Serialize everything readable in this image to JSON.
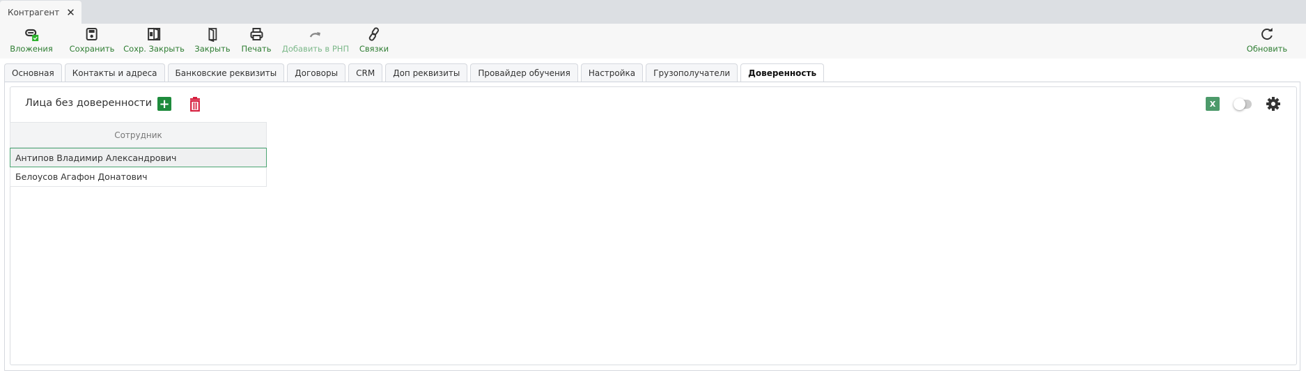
{
  "window_tab": {
    "title": "Контрагент",
    "close_icon": "close-icon"
  },
  "toolbar": {
    "attachments": "Вложения",
    "save": "Сохранить",
    "save_close": "Сохр. Закрыть",
    "close": "Закрыть",
    "print": "Печать",
    "add_rnp": "Добавить в РНП",
    "links": "Связки",
    "refresh": "Обновить"
  },
  "tabs": [
    "Основная",
    "Контакты и адреса",
    "Банковские реквизиты",
    "Договоры",
    "CRM",
    "Доп реквизиты",
    "Провайдер обучения",
    "Настройка",
    "Грузополучатели",
    "Доверенность"
  ],
  "active_tab": "Доверенность",
  "section": {
    "title": "Лица без доверенности",
    "excel_label": "X"
  },
  "grid": {
    "column": "Сотрудник",
    "rows": [
      "Антипов Владимир Александрович",
      "Белоусов Агафон Донатович"
    ]
  },
  "colors": {
    "accent": "#2e7d32",
    "add": "#1e8b3c",
    "delete": "#d6203f"
  }
}
